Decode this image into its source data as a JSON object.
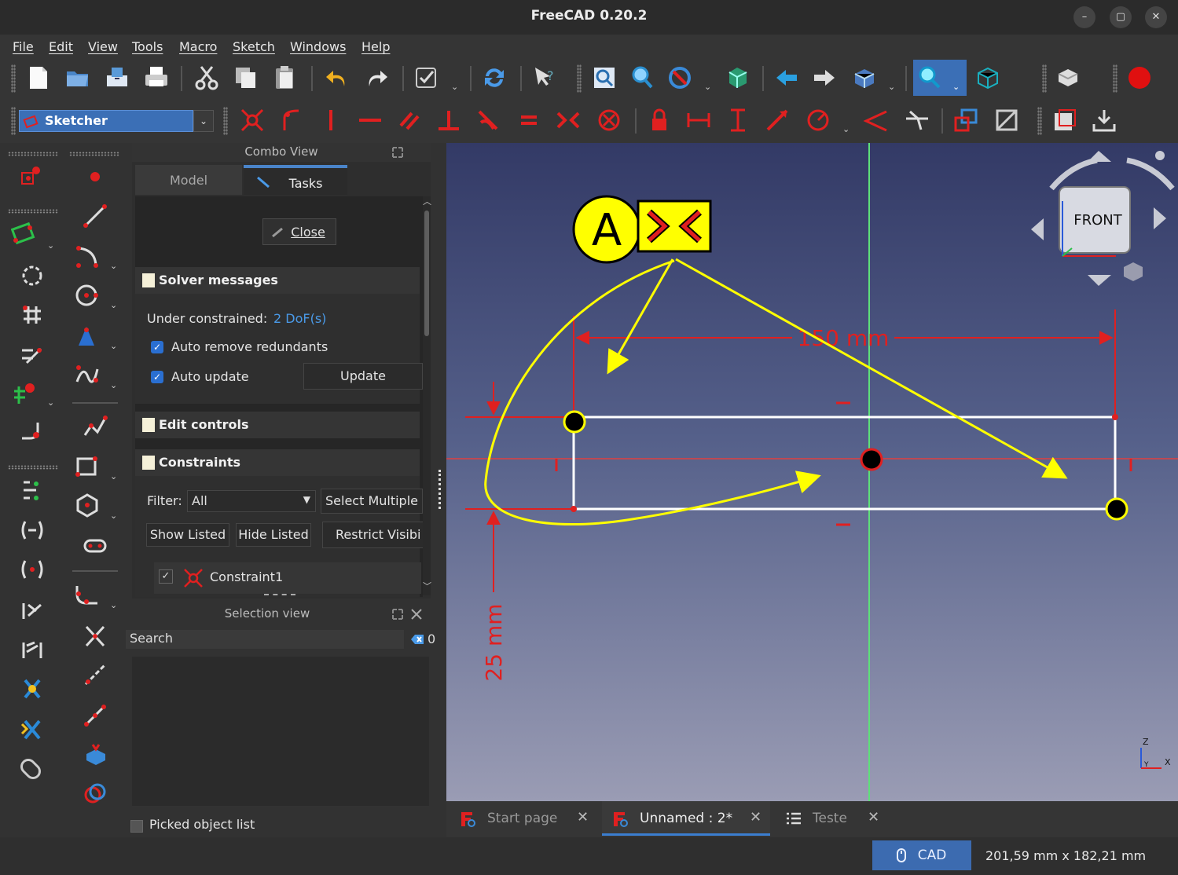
{
  "window": {
    "title": "FreeCAD 0.20.2",
    "min": "–",
    "max": "▢",
    "close": "✕"
  },
  "menubar": [
    "File",
    "Edit",
    "View",
    "Tools",
    "Macro",
    "Sketch",
    "Windows",
    "Help"
  ],
  "workbench": {
    "selected": "Sketcher",
    "drop": "⌄"
  },
  "combo_view": {
    "title": "Combo View",
    "tabs": {
      "model": "Model",
      "tasks": "Tasks"
    },
    "close_button": "Close",
    "solver": {
      "heading": "Solver messages",
      "status_label": "Under constrained:",
      "status_value": "2 DoF(s)",
      "auto_remove": "Auto remove redundants",
      "auto_update": "Auto update",
      "update_button": "Update"
    },
    "edit_controls": "Edit controls",
    "constraints": {
      "heading": "Constraints",
      "filter_label": "Filter:",
      "filter_value": "All",
      "select_multiple": "Select Multiple",
      "show_listed": "Show Listed",
      "hide_listed": "Hide Listed",
      "restrict": "Restrict Visibi",
      "item": "Constraint1",
      "check": "✓"
    }
  },
  "selection_view": {
    "title": "Selection view",
    "search": "Search",
    "count": "0",
    "picked": "Picked object list"
  },
  "viewport": {
    "annotation_letter": "A",
    "dim_horizontal": "150 mm",
    "dim_vertical": "25 mm",
    "navcube_face": "FRONT",
    "axis_z": "Z",
    "axis_x": "X",
    "axis_y": "Y"
  },
  "doc_tabs": [
    {
      "label": "Start page"
    },
    {
      "label": "Unnamed : 2*"
    },
    {
      "label": "Teste"
    }
  ],
  "status": {
    "nav_style": "CAD",
    "dimensions": "201,59 mm x 182,21 mm"
  },
  "colors": {
    "constraint_red": "#e02020",
    "accent_blue": "#3b6fb6",
    "annotation_yellow": "#ffff00"
  }
}
